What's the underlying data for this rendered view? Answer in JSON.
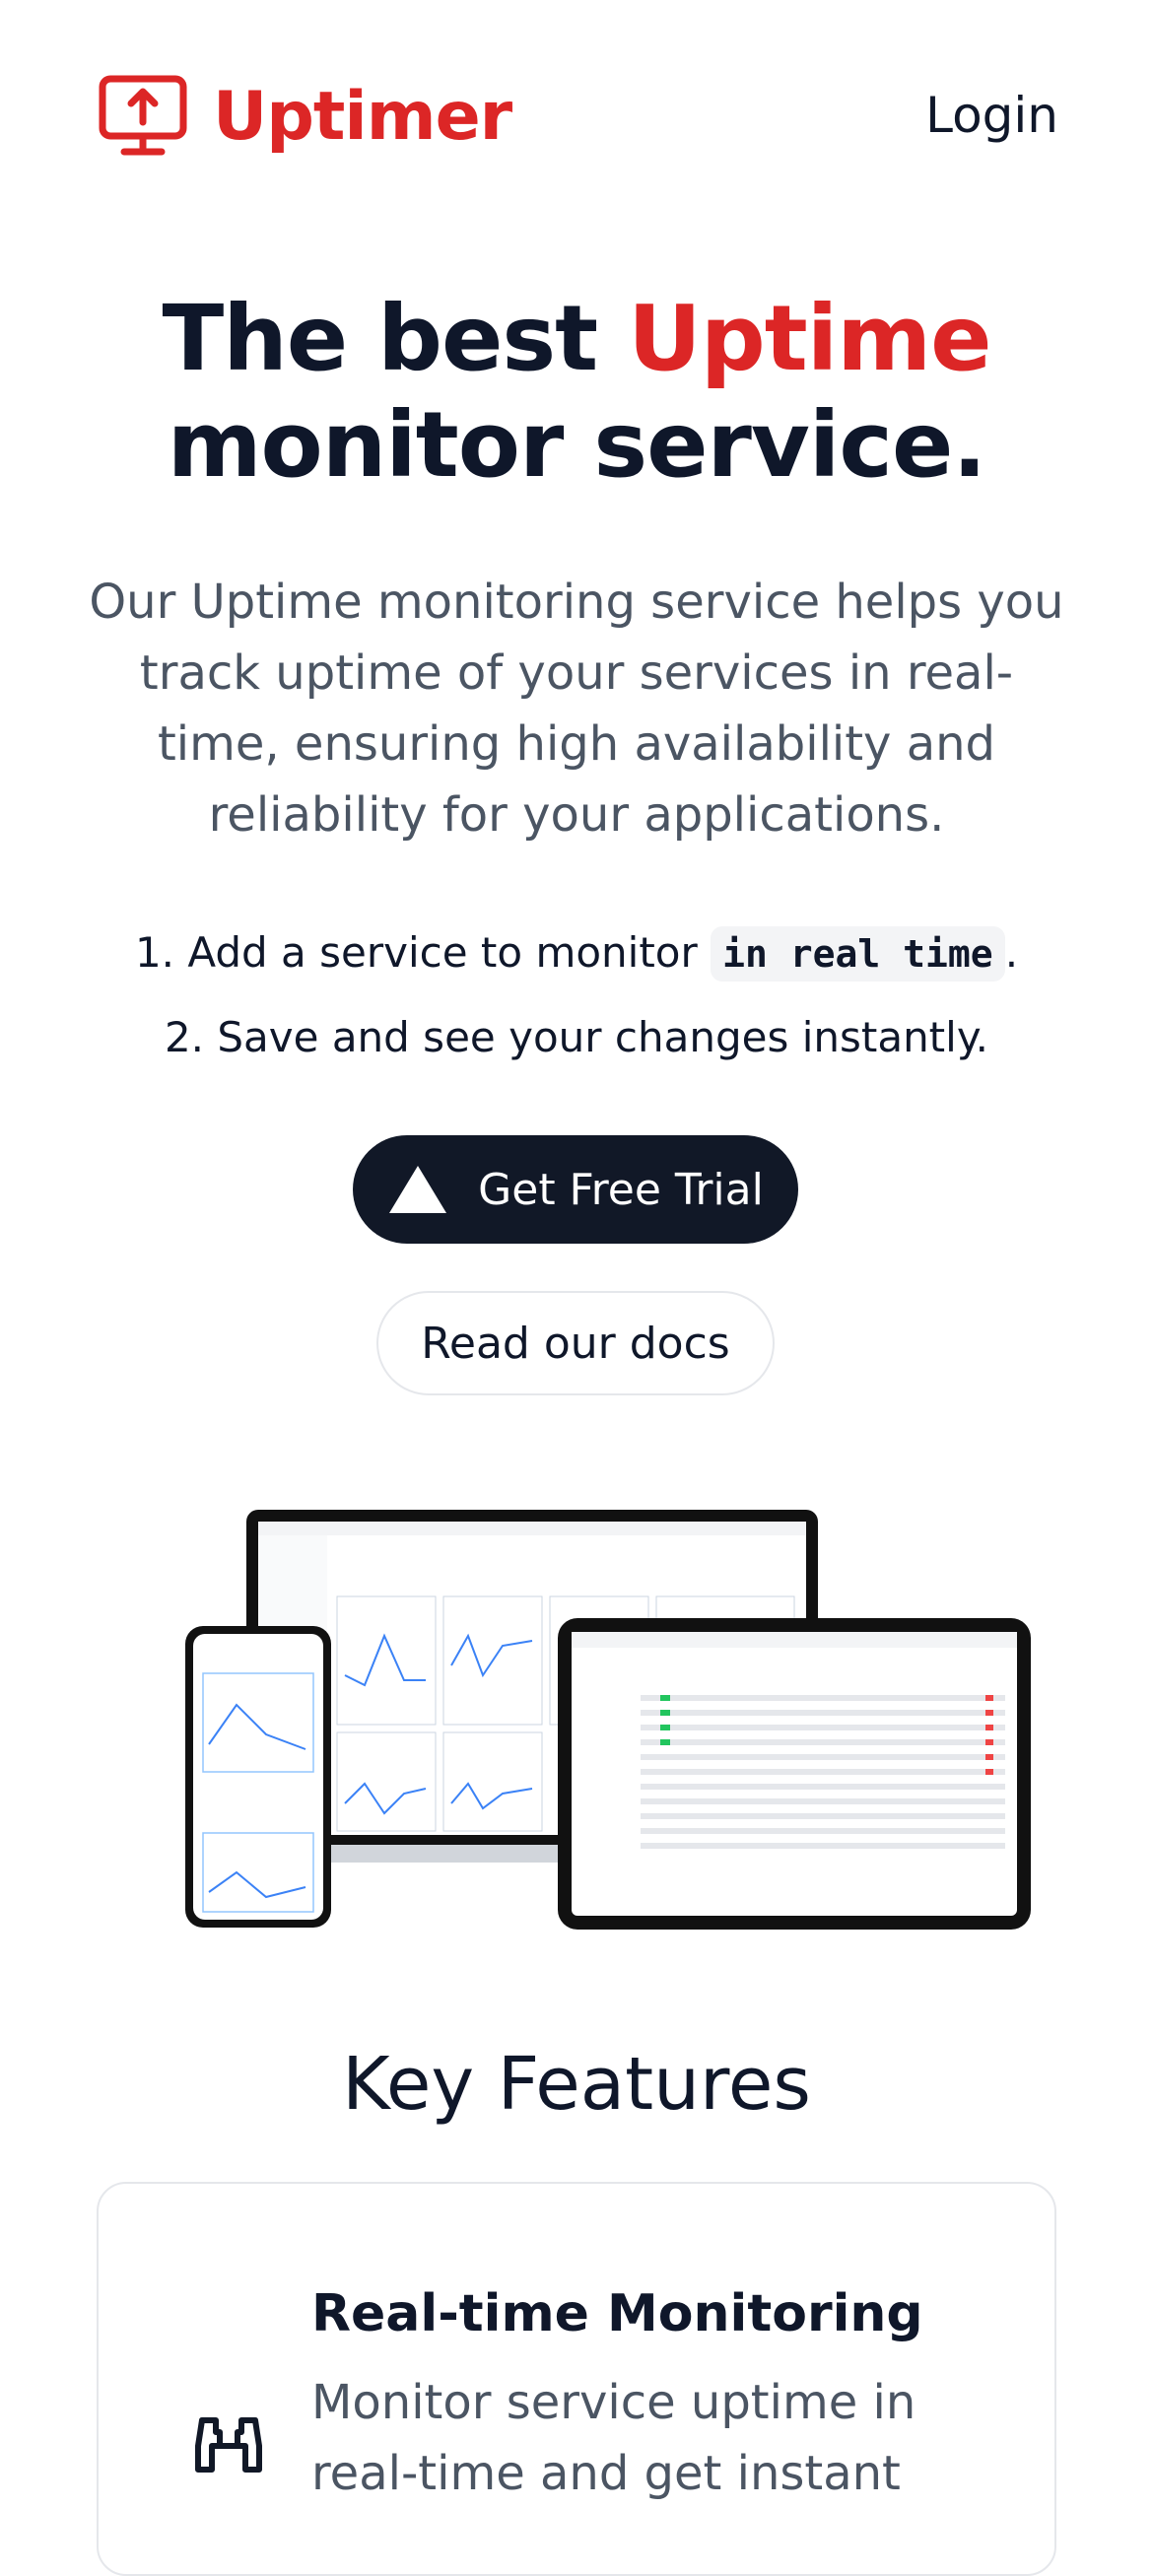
{
  "header": {
    "brand_name": "Uptimer",
    "login_label": "Login"
  },
  "hero": {
    "title_part1": "The best",
    "title_accent": "Uptime",
    "title_part2": "monitor service.",
    "description": "Our Uptime monitoring service helps you track uptime of your services in real-time, ensuring high availability and reliability for your applications.",
    "step1_prefix": "1. Add a service to monitor",
    "step1_code": "in real time",
    "step1_suffix": ".",
    "step2": "2. Save and see your changes instantly.",
    "primary_cta": "Get Free Trial",
    "secondary_cta": "Read our docs"
  },
  "features": {
    "section_title": "Key Features",
    "items": [
      {
        "title": "Real-time Monitoring",
        "description": "Monitor service uptime in real-time and get instant",
        "icon": "binoculars-icon"
      }
    ]
  },
  "colors": {
    "brand_red": "#dc2626",
    "dark": "#111827"
  }
}
